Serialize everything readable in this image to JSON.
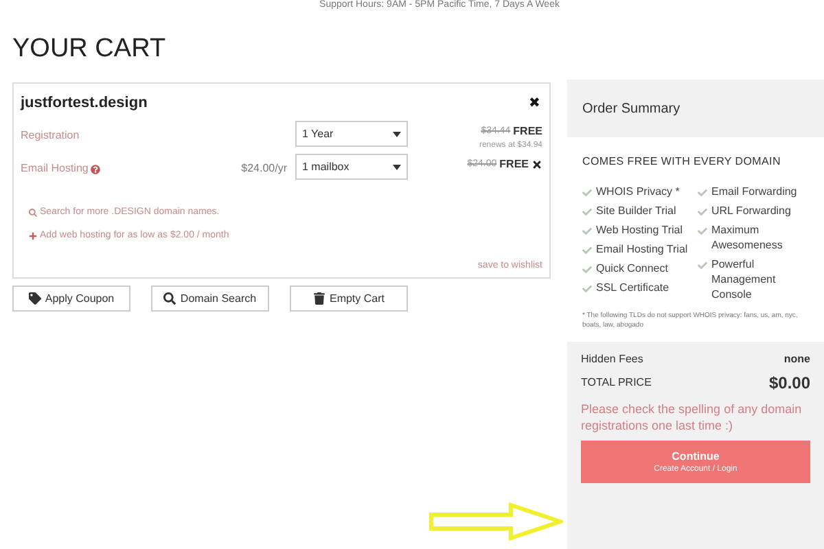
{
  "header": {
    "support_hours": "Support Hours: 9AM - 5PM Pacific Time, 7 Days A Week"
  },
  "page_title": "YOUR CART",
  "cart_item": {
    "domain": "justfortest.design",
    "remove": "✖",
    "lines": [
      {
        "label": "Registration",
        "help": false,
        "select": "1 Year",
        "old_price": "$34.44",
        "new_price": "FREE",
        "note": "renews at $34.94",
        "removable": false
      },
      {
        "label": "Email Hosting",
        "help": true,
        "price": "$24.00/yr",
        "select": "1 mailbox",
        "old_price": "$24.00",
        "new_price": "FREE",
        "removable": true
      }
    ],
    "links": [
      {
        "kind": "search",
        "text": "Search for more .DESIGN domain names."
      },
      {
        "kind": "add",
        "text": "Add web hosting for as low as $2.00 / month"
      }
    ],
    "wishlist": "save to wishlist"
  },
  "buttons": [
    {
      "kind": "tag",
      "label": "Apply Coupon"
    },
    {
      "kind": "search",
      "label": "Domain Search"
    },
    {
      "kind": "trash",
      "label": "Empty Cart"
    }
  ],
  "summary": {
    "title": "Order Summary",
    "free_heading": "COMES FREE WITH EVERY DOMAIN",
    "features_left": [
      "WHOIS Privacy *",
      "Site Builder Trial",
      "Web Hosting Trial",
      "Email Hosting Trial",
      "Quick Connect",
      "SSL Certificate"
    ],
    "features_right": [
      "Email Forwarding",
      "URL Forwarding",
      "Maximum Awesomeness",
      "Powerful Management Console"
    ],
    "footnote": "* The following TLDs do not support WHOIS privacy: fans, us, am, nyc, boats, law, abogado",
    "hidden_fees_label": "Hidden Fees",
    "hidden_fees_value": "none",
    "total_label": "TOTAL PRICE",
    "total_value": "$0.00",
    "warning": "Please check the spelling of any domain registrations one last time :)",
    "continue": {
      "title": "Continue",
      "subtitle": "Create Account / Login"
    }
  }
}
